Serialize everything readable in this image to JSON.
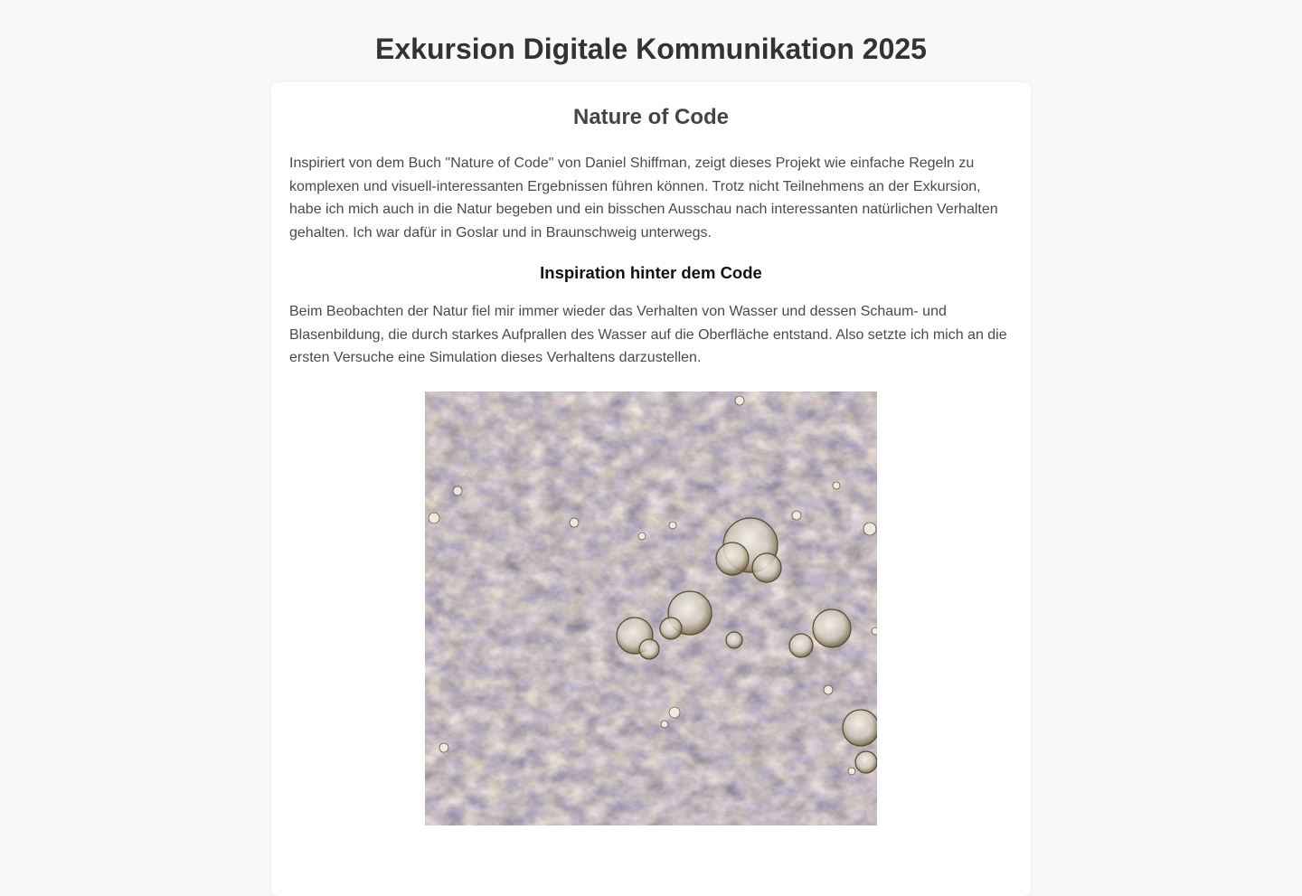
{
  "page": {
    "title": "Exkursion Digitale Kommunikation 2025"
  },
  "card": {
    "title": "Nature of Code",
    "intro": "Inspiriert von dem Buch \"Nature of Code\" von Daniel Shiffman, zeigt dieses Projekt wie einfache Regeln zu komplexen und visuell-interessanten Ergebnissen führen können. Trotz nicht Teilnehmens an der Exkursion, habe ich mich auch in die Natur begeben und ein bisschen Ausschau nach interessanten natürlichen Verhalten gehalten. Ich war dafür in Goslar und in Braunschweig unterwegs.",
    "section_heading": "Inspiration hinter dem Code",
    "section_text": "Beim Beobachten der Natur fiel mir immer wieder das Verhalten von Wasser und dessen Schaum- und Blasenbildung, die durch starkes Aufprallen des Wasser auf die Oberfläche entstand. Also setzte ich mich an die ersten Versuche eine Simulation dieses Verhaltens darzustellen."
  },
  "colors": {
    "background": "#f8f8f8",
    "card": "#ffffff",
    "title": "#333333",
    "text": "#4a4a4a"
  }
}
